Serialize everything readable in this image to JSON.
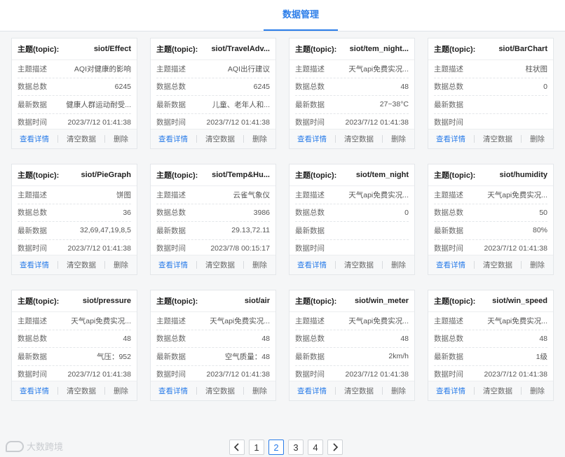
{
  "header": {
    "title": "数据管理"
  },
  "labels": {
    "topic": "主题(topic):",
    "desc": "主题描述",
    "count": "数据总数",
    "latest": "最新数据",
    "time": "数据时间",
    "detail": "查看详情",
    "clear": "清空数据",
    "delete": "删除"
  },
  "cards": [
    {
      "topic": "siot/Effect",
      "desc": "AQI对健康的影响",
      "count": "6245",
      "latest": "健康人群运动耐受...",
      "time": "2023/7/12 01:41:38"
    },
    {
      "topic": "siot/TravelAdv...",
      "desc": "AQI出行建议",
      "count": "6245",
      "latest": "儿童、老年人和...",
      "time": "2023/7/12 01:41:38"
    },
    {
      "topic": "siot/tem_night...",
      "desc": "天气api免费实况...",
      "count": "48",
      "latest": "27~38°C",
      "time": "2023/7/12 01:41:38"
    },
    {
      "topic": "siot/BarChart",
      "desc": "柱状图",
      "count": "0",
      "latest": "",
      "time": ""
    },
    {
      "topic": "siot/PieGraph",
      "desc": "饼图",
      "count": "36",
      "latest": "32,69,47,19,8,5",
      "time": "2023/7/12 01:41:38"
    },
    {
      "topic": "siot/Temp&Hu...",
      "desc": "云雀气象仪",
      "count": "3986",
      "latest": "29.13,72.11",
      "time": "2023/7/8 00:15:17"
    },
    {
      "topic": "siot/tem_night",
      "desc": "天气api免费实况...",
      "count": "0",
      "latest": "",
      "time": ""
    },
    {
      "topic": "siot/humidity",
      "desc": "天气api免费实况...",
      "count": "50",
      "latest": "80%",
      "time": "2023/7/12 01:41:38"
    },
    {
      "topic": "siot/pressure",
      "desc": "天气api免费实况...",
      "count": "48",
      "latest": "气压：952",
      "time": "2023/7/12 01:41:38"
    },
    {
      "topic": "siot/air",
      "desc": "天气api免费实况...",
      "count": "48",
      "latest": "空气质量：48",
      "time": "2023/7/12 01:41:38"
    },
    {
      "topic": "siot/win_meter",
      "desc": "天气api免费实况...",
      "count": "48",
      "latest": "2km/h",
      "time": "2023/7/12 01:41:38"
    },
    {
      "topic": "siot/win_speed",
      "desc": "天气api免费实况...",
      "count": "48",
      "latest": "1级",
      "time": "2023/7/12 01:41:38"
    }
  ],
  "pagination": {
    "pages": [
      "1",
      "2",
      "3",
      "4"
    ],
    "current": "2",
    "prev_icon": "chevron-left-icon",
    "next_icon": "chevron-right-icon"
  },
  "watermark": {
    "text": "大数跨境"
  },
  "colors": {
    "accent": "#2b7de9",
    "background": "#f5f6f7"
  }
}
